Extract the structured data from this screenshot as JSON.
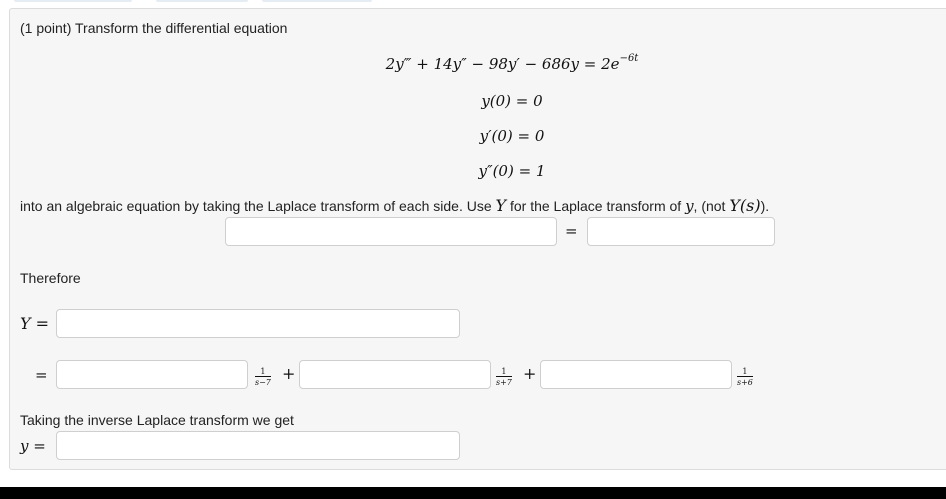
{
  "problem": {
    "intro": "(1 point) Transform the differential equation",
    "equation": {
      "lhs": "2y‴ + 14y″ − 98y′ − 686y = 2e",
      "exponent": "−6t"
    },
    "initial_conditions": [
      "y(0) = 0",
      "y′(0) = 0",
      "y″(0) = 1"
    ],
    "instruction": {
      "before_Y": "into an algebraic equation by taking the Laplace transform of each side. Use",
      "Y_symbol": "Y",
      "middle": "for the Laplace transform of",
      "y_symbol": "y",
      "after": ", (not",
      "Ys_symbol": "Y(s)",
      "end": ")."
    },
    "equals_sign": "=",
    "therefore_label": "Therefore",
    "Y_label": "Y =",
    "equals_label": "=",
    "partial_fractions": [
      {
        "numerator": "1",
        "denominator": "s−7",
        "operator": "+"
      },
      {
        "numerator": "1",
        "denominator": "s+7",
        "operator": "+"
      },
      {
        "numerator": "1",
        "denominator": "s+6",
        "operator": ""
      }
    ],
    "inverse_label": "Taking the inverse Laplace transform we get",
    "y_label": "y ="
  },
  "inputs": {
    "laplace_lhs": "",
    "laplace_rhs": "",
    "Y_expression": "",
    "coef_1": "",
    "coef_2": "",
    "coef_3": "",
    "y_solution": ""
  }
}
